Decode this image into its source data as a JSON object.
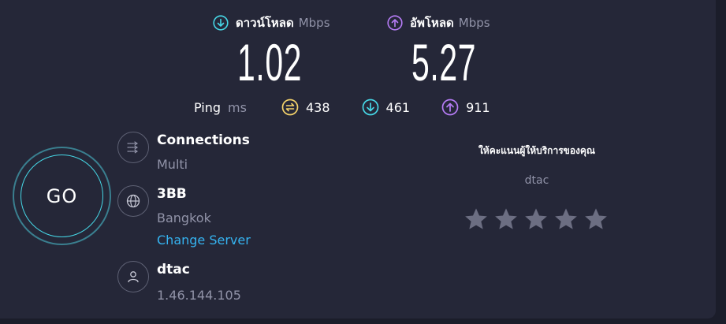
{
  "download": {
    "label": "ดาวน์โหลด",
    "unit": "Mbps",
    "value": "1.02"
  },
  "upload": {
    "label": "อัพโหลด",
    "unit": "Mbps",
    "value": "5.27"
  },
  "ping": {
    "label": "Ping",
    "unit": "ms",
    "idle": "438",
    "down": "461",
    "up": "911"
  },
  "go": {
    "label": "GO"
  },
  "connections": {
    "title": "Connections",
    "value": "Multi"
  },
  "server": {
    "name": "3BB",
    "location": "Bangkok",
    "change_label": "Change Server"
  },
  "client": {
    "isp": "dtac",
    "ip": "1.46.144.105"
  },
  "rating": {
    "title": "ให้คะแนนผู้ให้บริการของคุณ",
    "isp": "dtac",
    "stars": 5
  },
  "colors": {
    "background": "#252738",
    "download": "#46d7e6",
    "upload": "#b67cf6",
    "ping": "#f5d36a",
    "link": "#35b3f0",
    "star": "#6c6e82"
  }
}
